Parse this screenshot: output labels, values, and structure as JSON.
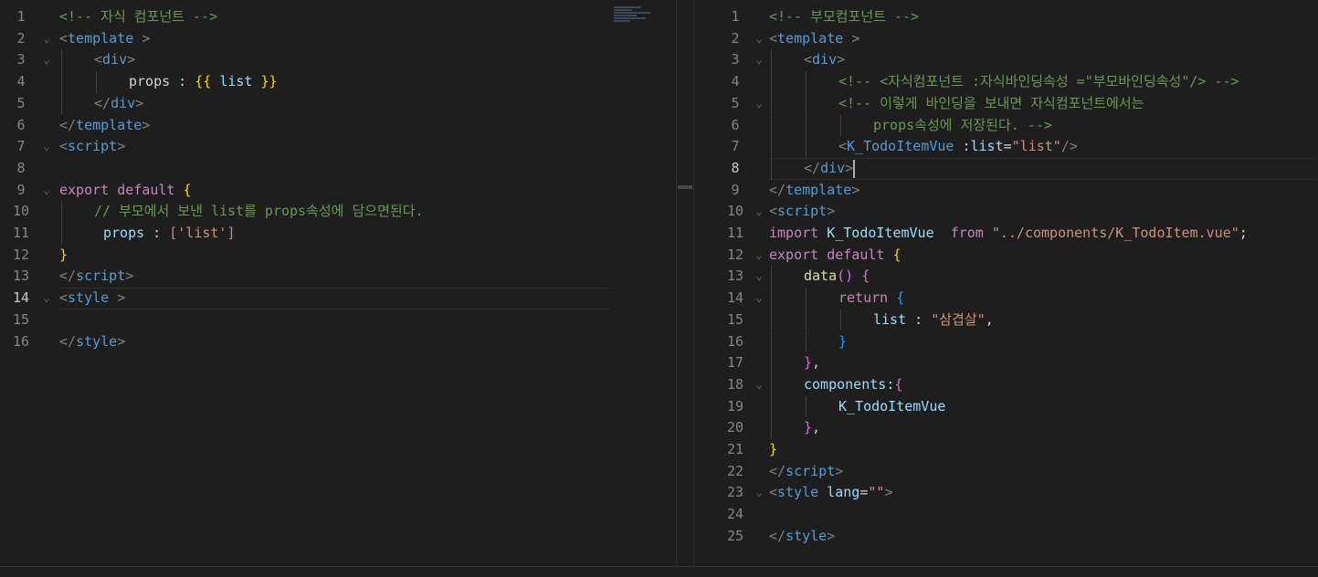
{
  "left_editor": {
    "lines": [
      {
        "n": "1",
        "fold": "",
        "indent": 0,
        "segs": [
          [
            "cm",
            "<!-- 자식 컴포넌트 -->"
          ]
        ]
      },
      {
        "n": "2",
        "fold": "⌄",
        "indent": 0,
        "segs": [
          [
            "br",
            "<"
          ],
          [
            "tg",
            "template"
          ],
          [
            "pl",
            " "
          ],
          [
            "br",
            ">"
          ]
        ]
      },
      {
        "n": "3",
        "fold": "⌄",
        "indent": 1,
        "segs": [
          [
            "br",
            "<"
          ],
          [
            "tg",
            "div"
          ],
          [
            "br",
            ">"
          ]
        ]
      },
      {
        "n": "4",
        "fold": "",
        "indent": 2,
        "segs": [
          [
            "pl",
            "props : "
          ],
          [
            "y",
            "{{"
          ],
          [
            "pl",
            " "
          ],
          [
            "at",
            "list"
          ],
          [
            "pl",
            " "
          ],
          [
            "y",
            "}}"
          ]
        ]
      },
      {
        "n": "5",
        "fold": "",
        "indent": 1,
        "segs": [
          [
            "br",
            "</"
          ],
          [
            "tg",
            "div"
          ],
          [
            "br",
            ">"
          ]
        ]
      },
      {
        "n": "6",
        "fold": "",
        "indent": 0,
        "segs": [
          [
            "br",
            "</"
          ],
          [
            "tg",
            "template"
          ],
          [
            "br",
            ">"
          ]
        ]
      },
      {
        "n": "7",
        "fold": "⌄",
        "indent": 0,
        "segs": [
          [
            "br",
            "<"
          ],
          [
            "tg",
            "script"
          ],
          [
            "br",
            ">"
          ]
        ]
      },
      {
        "n": "8",
        "fold": "",
        "indent": 0,
        "segs": []
      },
      {
        "n": "9",
        "fold": "⌄",
        "indent": 0,
        "segs": [
          [
            "cf",
            "export"
          ],
          [
            "pl",
            " "
          ],
          [
            "cf",
            "default"
          ],
          [
            "pl",
            " "
          ],
          [
            "y",
            "{"
          ]
        ]
      },
      {
        "n": "10",
        "fold": "",
        "indent": 1,
        "segs": [
          [
            "cm",
            "// 부모에서 보낸 list를 props속성에 담으면된다."
          ]
        ]
      },
      {
        "n": "11",
        "fold": "",
        "indent": 1,
        "pad": 10,
        "segs": [
          [
            "id",
            "props"
          ],
          [
            "pl",
            " : "
          ],
          [
            "m",
            "["
          ],
          [
            "st",
            "'list'"
          ],
          [
            "m",
            "]"
          ]
        ]
      },
      {
        "n": "12",
        "fold": "",
        "indent": 0,
        "segs": [
          [
            "y",
            "}"
          ]
        ]
      },
      {
        "n": "13",
        "fold": "",
        "indent": 0,
        "segs": [
          [
            "br",
            "</"
          ],
          [
            "tg",
            "script"
          ],
          [
            "br",
            ">"
          ]
        ]
      },
      {
        "n": "14",
        "fold": "⌄",
        "indent": 0,
        "active": true,
        "segs": [
          [
            "br",
            "<"
          ],
          [
            "tg",
            "style"
          ],
          [
            "pl",
            " "
          ],
          [
            "br",
            ">"
          ]
        ]
      },
      {
        "n": "15",
        "fold": "",
        "indent": 0,
        "segs": []
      },
      {
        "n": "16",
        "fold": "",
        "indent": 0,
        "segs": [
          [
            "br",
            "</"
          ],
          [
            "tg",
            "style"
          ],
          [
            "br",
            ">"
          ]
        ]
      }
    ]
  },
  "right_editor": {
    "lines": [
      {
        "n": "1",
        "fold": "",
        "indent": 0,
        "segs": [
          [
            "cm",
            "<!-- 부모컴포넌트 -->"
          ]
        ]
      },
      {
        "n": "2",
        "fold": "⌄",
        "indent": 0,
        "segs": [
          [
            "br",
            "<"
          ],
          [
            "tg",
            "template"
          ],
          [
            "pl",
            " "
          ],
          [
            "br",
            ">"
          ]
        ]
      },
      {
        "n": "3",
        "fold": "⌄",
        "indent": 1,
        "segs": [
          [
            "br",
            "<"
          ],
          [
            "tg",
            "div"
          ],
          [
            "br",
            ">"
          ]
        ]
      },
      {
        "n": "4",
        "fold": "",
        "indent": 2,
        "segs": [
          [
            "cm",
            "<!-- <자식컴포넌트 :자식바인딩속성 =\"부모바인딩속성\"/> -->"
          ]
        ]
      },
      {
        "n": "5",
        "fold": "⌄",
        "indent": 2,
        "segs": [
          [
            "cm",
            "<!-- 이렇게 바인딩을 보내면 자식컴포넌트에서는"
          ]
        ]
      },
      {
        "n": "6",
        "fold": "",
        "indent": 3,
        "segs": [
          [
            "cm",
            "props속성에 저장된다. -->"
          ]
        ]
      },
      {
        "n": "7",
        "fold": "",
        "indent": 2,
        "segs": [
          [
            "br",
            "<"
          ],
          [
            "tg",
            "K_TodoItemVue"
          ],
          [
            "pl",
            " "
          ],
          [
            "at",
            ":list"
          ],
          [
            "pl",
            "="
          ],
          [
            "st",
            "\"list\""
          ],
          [
            "br",
            "/>"
          ]
        ]
      },
      {
        "n": "8",
        "fold": "",
        "indent": 1,
        "active": true,
        "caret": true,
        "segs": [
          [
            "br",
            "</"
          ],
          [
            "tg",
            "div"
          ],
          [
            "br",
            ">"
          ]
        ]
      },
      {
        "n": "9",
        "fold": "",
        "indent": 0,
        "segs": [
          [
            "br",
            "</"
          ],
          [
            "tg",
            "template"
          ],
          [
            "br",
            ">"
          ]
        ]
      },
      {
        "n": "10",
        "fold": "⌄",
        "indent": 0,
        "segs": [
          [
            "br",
            "<"
          ],
          [
            "tg",
            "script"
          ],
          [
            "br",
            ">"
          ]
        ]
      },
      {
        "n": "11",
        "fold": "",
        "indent": 0,
        "segs": [
          [
            "cf",
            "import"
          ],
          [
            "pl",
            " "
          ],
          [
            "id",
            "K_TodoItemVue"
          ],
          [
            "pl",
            "  "
          ],
          [
            "cf",
            "from"
          ],
          [
            "pl",
            " "
          ],
          [
            "st",
            "\"../components/K_TodoItem.vue\""
          ],
          [
            "pl",
            ";"
          ]
        ]
      },
      {
        "n": "12",
        "fold": "⌄",
        "indent": 0,
        "segs": [
          [
            "cf",
            "export"
          ],
          [
            "pl",
            " "
          ],
          [
            "cf",
            "default"
          ],
          [
            "pl",
            " "
          ],
          [
            "y",
            "{"
          ]
        ]
      },
      {
        "n": "13",
        "fold": "⌄",
        "indent": 1,
        "segs": [
          [
            "fn",
            "data"
          ],
          [
            "m",
            "()"
          ],
          [
            "pl",
            " "
          ],
          [
            "m",
            "{"
          ]
        ]
      },
      {
        "n": "14",
        "fold": "⌄",
        "indent": 2,
        "segs": [
          [
            "cf",
            "return"
          ],
          [
            "pl",
            " "
          ],
          [
            "b",
            "{"
          ]
        ]
      },
      {
        "n": "15",
        "fold": "",
        "indent": 3,
        "segs": [
          [
            "id",
            "list"
          ],
          [
            "pl",
            " : "
          ],
          [
            "st",
            "\"삼겹살\""
          ],
          [
            "pl",
            ","
          ]
        ]
      },
      {
        "n": "16",
        "fold": "",
        "indent": 2,
        "segs": [
          [
            "b",
            "}"
          ]
        ]
      },
      {
        "n": "17",
        "fold": "",
        "indent": 1,
        "segs": [
          [
            "m",
            "}"
          ],
          [
            "pl",
            ","
          ]
        ]
      },
      {
        "n": "18",
        "fold": "⌄",
        "indent": 1,
        "segs": [
          [
            "id",
            "components"
          ],
          [
            "pl",
            ":"
          ],
          [
            "m",
            "{"
          ]
        ]
      },
      {
        "n": "19",
        "fold": "",
        "indent": 2,
        "segs": [
          [
            "id",
            "K_TodoItemVue"
          ]
        ]
      },
      {
        "n": "20",
        "fold": "",
        "indent": 1,
        "segs": [
          [
            "m",
            "}"
          ],
          [
            "pl",
            ","
          ]
        ]
      },
      {
        "n": "21",
        "fold": "",
        "indent": 0,
        "segs": [
          [
            "y",
            "}"
          ]
        ]
      },
      {
        "n": "22",
        "fold": "",
        "indent": 0,
        "segs": [
          [
            "br",
            "</"
          ],
          [
            "tg",
            "script"
          ],
          [
            "br",
            ">"
          ]
        ]
      },
      {
        "n": "23",
        "fold": "⌄",
        "indent": 0,
        "segs": [
          [
            "br",
            "<"
          ],
          [
            "tg",
            "style"
          ],
          [
            "pl",
            " "
          ],
          [
            "at",
            "lang"
          ],
          [
            "pl",
            "="
          ],
          [
            "st",
            "\"\""
          ],
          [
            "br",
            ">"
          ]
        ]
      },
      {
        "n": "24",
        "fold": "",
        "indent": 0,
        "segs": []
      },
      {
        "n": "25",
        "fold": "",
        "indent": 0,
        "segs": [
          [
            "br",
            "</"
          ],
          [
            "tg",
            "style"
          ],
          [
            "br",
            ">"
          ]
        ]
      }
    ]
  }
}
